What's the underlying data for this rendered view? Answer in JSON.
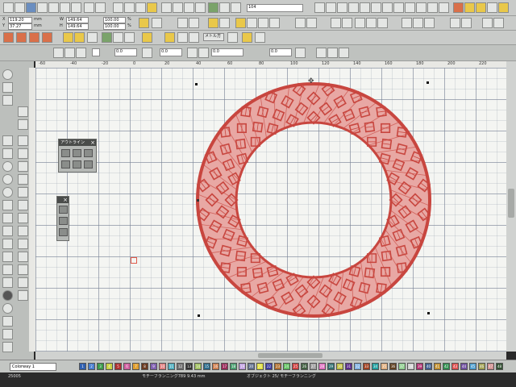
{
  "toolbar": {
    "pos_x": "119.20",
    "pos_y": "37.27",
    "width": "149.64",
    "height": "149.64",
    "scale_w": "100.00",
    "scale_h": "100.00",
    "unit_mm1": "mm",
    "unit_mm2": "mm",
    "unit_pct1": "%",
    "unit_pct2": "%",
    "object_no": "104",
    "stitch_type_label": "メトル方",
    "spacing_1": "0.0",
    "spacing_2": "0.0",
    "spacing_3": "0.0",
    "spacing_4": "0.0"
  },
  "ruler": {
    "h_ticks": [
      "-60",
      "-40",
      "-20",
      "0",
      "20",
      "40",
      "60",
      "80",
      "100",
      "120",
      "140",
      "160",
      "180",
      "200",
      "220"
    ]
  },
  "panels": {
    "outline_title": "アウトライン"
  },
  "palette": {
    "colorway": "Colorway 1",
    "swatches": [
      {
        "n": "1",
        "c": "#2f5fb0"
      },
      {
        "n": "2",
        "c": "#4a7fd0"
      },
      {
        "n": "3",
        "c": "#3a9a4a"
      },
      {
        "n": "4",
        "c": "#c8d040"
      },
      {
        "n": "5",
        "c": "#b03030"
      },
      {
        "n": "6",
        "c": "#d060a0"
      },
      {
        "n": "7",
        "c": "#e0a030"
      },
      {
        "n": "8",
        "c": "#6a3a20"
      },
      {
        "n": "9",
        "c": "#8060b0"
      },
      {
        "n": "10",
        "c": "#e08080"
      },
      {
        "n": "11",
        "c": "#50b0c0"
      },
      {
        "n": "12",
        "c": "#707070"
      },
      {
        "n": "13",
        "c": "#303030"
      },
      {
        "n": "14",
        "c": "#a0c060"
      },
      {
        "n": "15",
        "c": "#2a6a8a"
      },
      {
        "n": "16",
        "c": "#d08050"
      },
      {
        "n": "17",
        "c": "#9a2a5a"
      },
      {
        "n": "18",
        "c": "#4aa070"
      },
      {
        "n": "19",
        "c": "#c0a0e0"
      },
      {
        "n": "20",
        "c": "#607090"
      },
      {
        "n": "21",
        "c": "#e0e040"
      },
      {
        "n": "22",
        "c": "#3a3aa0"
      },
      {
        "n": "23",
        "c": "#b07030"
      },
      {
        "n": "24",
        "c": "#60c060"
      },
      {
        "n": "25",
        "c": "#d04040"
      },
      {
        "n": "26",
        "c": "#406040"
      },
      {
        "n": "27",
        "c": "#a0a0a0"
      },
      {
        "n": "28",
        "c": "#e070c0"
      },
      {
        "n": "29",
        "c": "#307070"
      },
      {
        "n": "30",
        "c": "#c0c040"
      },
      {
        "n": "31",
        "c": "#5a2a8a"
      },
      {
        "n": "32",
        "c": "#80b0e0"
      },
      {
        "n": "33",
        "c": "#a04020"
      },
      {
        "n": "34",
        "c": "#20a0a0"
      },
      {
        "n": "35",
        "c": "#e0b080"
      },
      {
        "n": "36",
        "c": "#604020"
      },
      {
        "n": "37",
        "c": "#90d090"
      },
      {
        "n": "38",
        "c": "#d0d0d0"
      },
      {
        "n": "39",
        "c": "#b03070"
      },
      {
        "n": "40",
        "c": "#406090"
      },
      {
        "n": "41",
        "c": "#c09030"
      },
      {
        "n": "42",
        "c": "#309050"
      },
      {
        "n": "43",
        "c": "#e05050"
      },
      {
        "n": "44",
        "c": "#7050a0"
      },
      {
        "n": "45",
        "c": "#50a0d0"
      },
      {
        "n": "46",
        "c": "#a0a050"
      },
      {
        "n": "47",
        "c": "#d09090"
      },
      {
        "n": "48",
        "c": "#305030"
      }
    ]
  },
  "status": {
    "code": "25005",
    "left_info": "モチーフランニング789",
    "measure": "9.43 mm",
    "object_info": "オブジェクト 25/ モチーフランニング"
  },
  "design": {
    "thread_color": "#c8463f",
    "fill_color": "#e8a8a4"
  }
}
